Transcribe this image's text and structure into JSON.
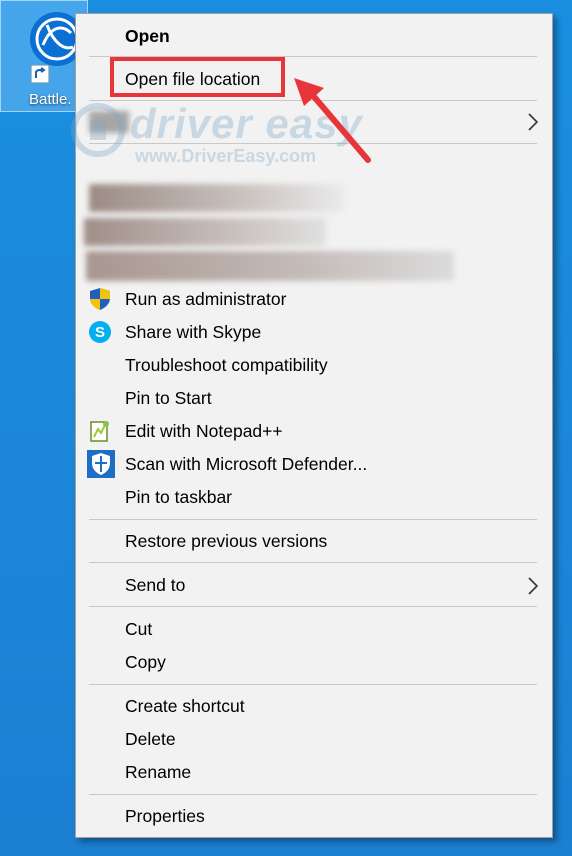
{
  "desktop_icon": {
    "label": "Battle.",
    "icon": "battlenet-logo-icon"
  },
  "watermark": {
    "title": "driver easy",
    "url": "www.DriverEasy.com"
  },
  "menu": {
    "open": "Open",
    "open_file_location": "Open file location",
    "run_as_admin": "Run as administrator",
    "share_skype": "Share with Skype",
    "troubleshoot": "Troubleshoot compatibility",
    "pin_start": "Pin to Start",
    "edit_notepad": "Edit with Notepad++",
    "scan_defender": "Scan with Microsoft Defender...",
    "pin_taskbar": "Pin to taskbar",
    "restore_versions": "Restore previous versions",
    "send_to": "Send to",
    "cut": "Cut",
    "copy": "Copy",
    "create_shortcut": "Create shortcut",
    "delete": "Delete",
    "rename": "Rename",
    "properties": "Properties"
  },
  "icons": {
    "shield": "uac-shield-icon",
    "skype": "skype-icon",
    "notepad": "notepad-plus-plus-icon",
    "defender": "defender-shield-icon",
    "chevron": "chevron-right-icon"
  },
  "colors": {
    "highlight": "#e8353a",
    "accent": "#1a8fe0"
  }
}
